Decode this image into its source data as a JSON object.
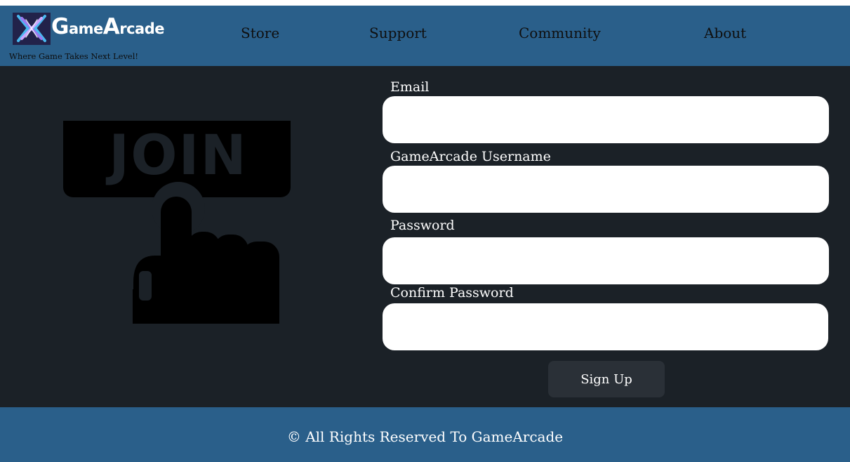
{
  "brand": {
    "name_first_initial": "G",
    "name_first_rest": "ame",
    "name_second_initial": "A",
    "name_second_rest": "rcade",
    "tagline": "Where Game Takes Next Level!"
  },
  "nav": {
    "items": [
      {
        "label": "Store"
      },
      {
        "label": "Support"
      },
      {
        "label": "Community"
      },
      {
        "label": "About"
      }
    ]
  },
  "illustration": {
    "banner_text": "JOIN",
    "icon": "pointing-hand-icon"
  },
  "form": {
    "fields": [
      {
        "label": "Email",
        "value": ""
      },
      {
        "label": "GameArcade Username",
        "value": ""
      },
      {
        "label": "Password",
        "value": ""
      },
      {
        "label": "Confirm Password",
        "value": ""
      }
    ],
    "submit_label": "Sign Up"
  },
  "footer": {
    "text": "© All Rights Reserved To GameArcade"
  },
  "colors": {
    "header_bg": "#2a5f8a",
    "page_bg": "#1b2127",
    "button_bg": "#2a3037",
    "logo_mark_bg": "#22224a"
  }
}
